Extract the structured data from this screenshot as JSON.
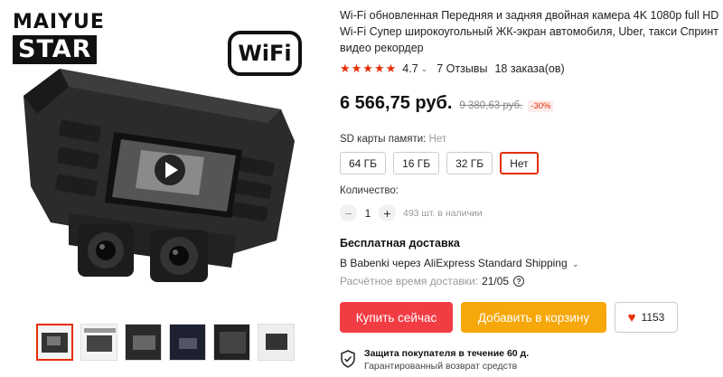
{
  "brand": {
    "top": "MAIYUE",
    "bottom": "STAR"
  },
  "wifi_badge": "WiFi",
  "product": {
    "title": "Wi-Fi обновленная Передняя и задняя двойная камера 4K 1080p full HD Wi-Fi Супер широкоугольный ЖК-экран автомобиля, Uber, такси Спринт видео рекордер",
    "rating": "4.7",
    "stars": "★★★★★",
    "reviews": "7 Отзывы",
    "orders": "18 заказа(ов)",
    "price": "6 566,75 руб.",
    "old_price": "9 380,63 руб.",
    "discount": "-30%"
  },
  "sd_card": {
    "label": "SD карты памяти:",
    "selected": "Нет",
    "options": [
      "64 ГБ",
      "16 ГБ",
      "32 ГБ",
      "Нет"
    ]
  },
  "quantity": {
    "label": "Количество:",
    "minus": "−",
    "plus": "+",
    "value": "1",
    "stock": "493 шт. в наличии"
  },
  "shipping": {
    "title": "Бесплатная доставка",
    "line": "В Babenki через AliExpress Standard Shipping",
    "caret": "⌄",
    "eta_label": "Расчётное время доставки:",
    "eta_date": "21/05",
    "help": "?"
  },
  "actions": {
    "buy": "Купить сейчас",
    "cart": "Добавить в корзину",
    "wishlist_count": "1153",
    "heart": "♥"
  },
  "protection": {
    "title": "Защита покупателя в течение 60 д.",
    "subtitle": "Гарантированный возврат средств"
  },
  "colors": {
    "accent_red": "#e62e04",
    "buy_button": "#f23c44",
    "cart_button": "#f6a70a"
  }
}
